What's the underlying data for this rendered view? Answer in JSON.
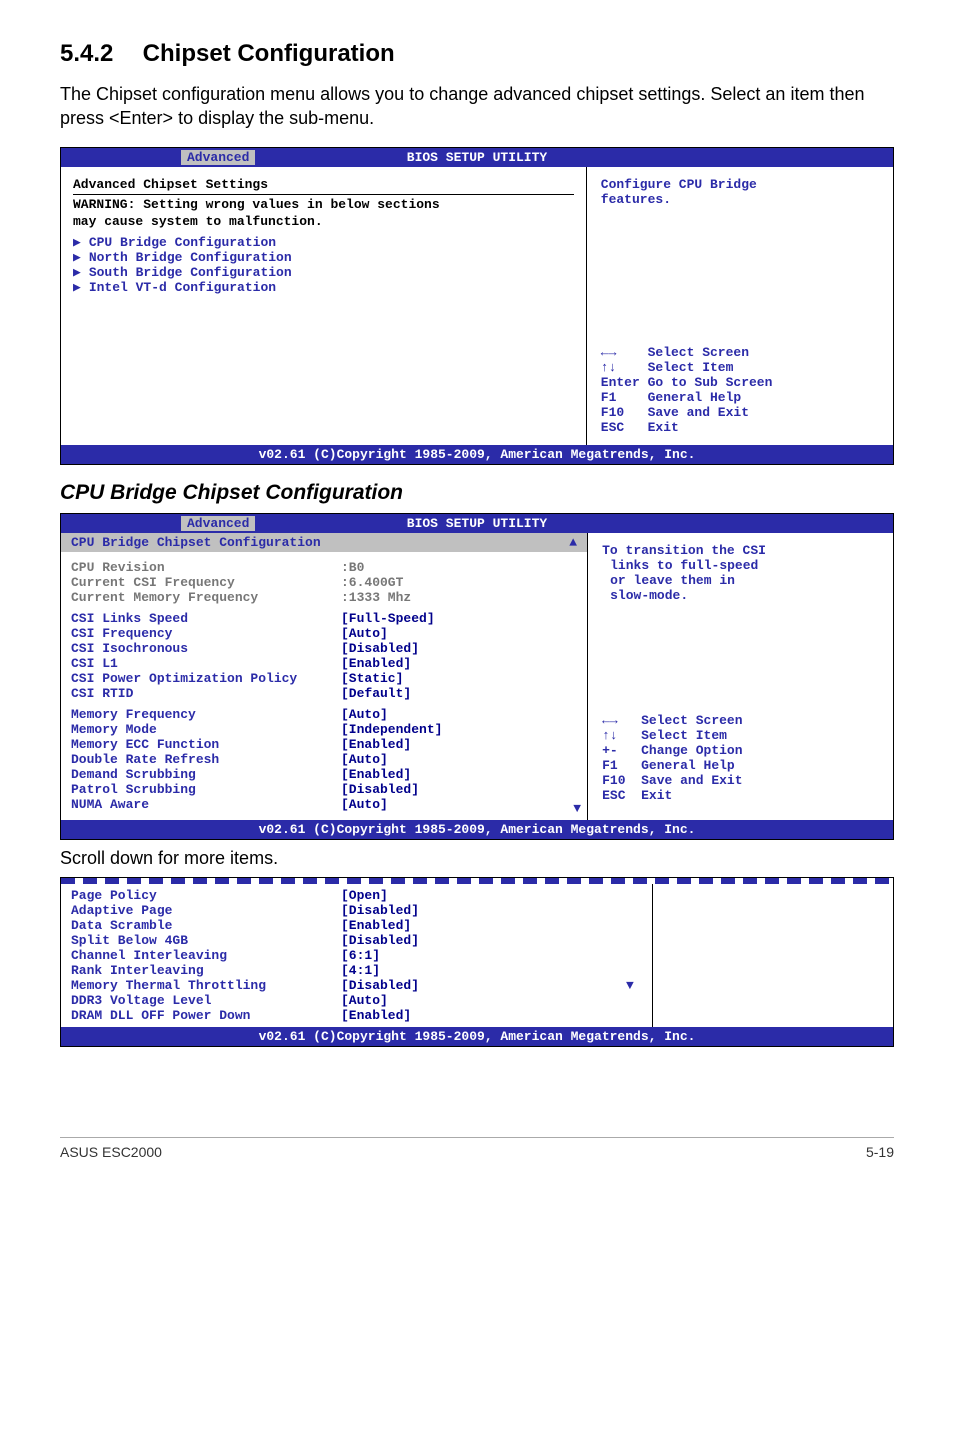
{
  "section": {
    "number": "5.4.2",
    "title": "Chipset Configuration"
  },
  "intro": "The Chipset configuration menu allows you to change advanced chipset settings. Select an item then press <Enter> to display the sub-menu.",
  "bios_title": "BIOS SETUP UTILITY",
  "tab": "Advanced",
  "screen1": {
    "heading": "Advanced Chipset Settings",
    "warning_l1": "WARNING: Setting wrong values in below sections",
    "warning_l2": "         may cause system to malfunction.",
    "items": [
      "CPU Bridge Configuration",
      "North Bridge Configuration",
      "South Bridge Configuration",
      "Intel VT-d Configuration"
    ],
    "help_l1": "Configure CPU Bridge",
    "help_l2": "features."
  },
  "nav1": {
    "r1": "←→    Select Screen",
    "r2": "↑↓    Select Item",
    "r3": "Enter Go to Sub Screen",
    "r4": "F1    General Help",
    "r5": "F10   Save and Exit",
    "r6": "ESC   Exit"
  },
  "footer_bar": "v02.61 (C)Copyright 1985-2009, American Megatrends, Inc.",
  "subhead": "CPU Bridge Chipset Configuration",
  "screen2": {
    "heading": "CPU Bridge Chipset Configuration",
    "fixed": [
      {
        "k": "CPU Revision",
        "v": ":B0"
      },
      {
        "k": "Current CSI Frequency",
        "v": ":6.400GT"
      },
      {
        "k": "Current Memory Frequency",
        "v": ":1333 Mhz"
      }
    ],
    "group1": [
      {
        "k": "CSI Links Speed",
        "v": "[Full-Speed]"
      },
      {
        "k": "CSI Frequency",
        "v": "[Auto]"
      },
      {
        "k": "CSI Isochronous",
        "v": "[Disabled]"
      },
      {
        "k": "CSI L1",
        "v": "[Enabled]"
      },
      {
        "k": "CSI Power Optimization Policy",
        "v": "[Static]"
      },
      {
        "k": "CSI RTID",
        "v": "[Default]"
      }
    ],
    "group2": [
      {
        "k": "Memory Frequency",
        "v": "[Auto]"
      },
      {
        "k": "Memory Mode",
        "v": "[Independent]"
      },
      {
        "k": "Memory ECC Function",
        "v": "[Enabled]"
      },
      {
        "k": "Double Rate Refresh",
        "v": "[Auto]"
      },
      {
        "k": "Demand Scrubbing",
        "v": "[Enabled]"
      },
      {
        "k": "Patrol Scrubbing",
        "v": "[Disabled]"
      },
      {
        "k": "NUMA Aware",
        "v": "[Auto]"
      }
    ],
    "help": [
      "To transition the CSI",
      "links to full-speed",
      "or leave them in",
      "slow-mode."
    ]
  },
  "nav2": {
    "r1": "←→   Select Screen",
    "r2": "↑↓   Select Item",
    "r3": "+-   Change Option",
    "r4": "F1   General Help",
    "r5": "F10  Save and Exit",
    "r6": "ESC  Exit"
  },
  "scroll_text": "Scroll down for more items.",
  "screen3": [
    {
      "k": "Page Policy",
      "v": "[Open]",
      "m": ""
    },
    {
      "k": "Adaptive Page",
      "v": "[Disabled]",
      "m": ""
    },
    {
      "k": "Data Scramble",
      "v": "[Enabled]",
      "m": ""
    },
    {
      "k": "Split Below 4GB",
      "v": "[Disabled]",
      "m": ""
    },
    {
      "k": "Channel Interleaving",
      "v": "[6:1]",
      "m": ""
    },
    {
      "k": "Rank Interleaving",
      "v": "[4:1]",
      "m": ""
    },
    {
      "k": "Memory Thermal Throttling",
      "v": "[Disabled]",
      "m": "▼"
    },
    {
      "k": "DDR3 Voltage Level",
      "v": "[Auto]",
      "m": ""
    },
    {
      "k": "DRAM DLL OFF Power Down",
      "v": "[Enabled]",
      "m": ""
    }
  ],
  "page_footer": {
    "left": "ASUS ESC2000",
    "right": "5-19"
  }
}
